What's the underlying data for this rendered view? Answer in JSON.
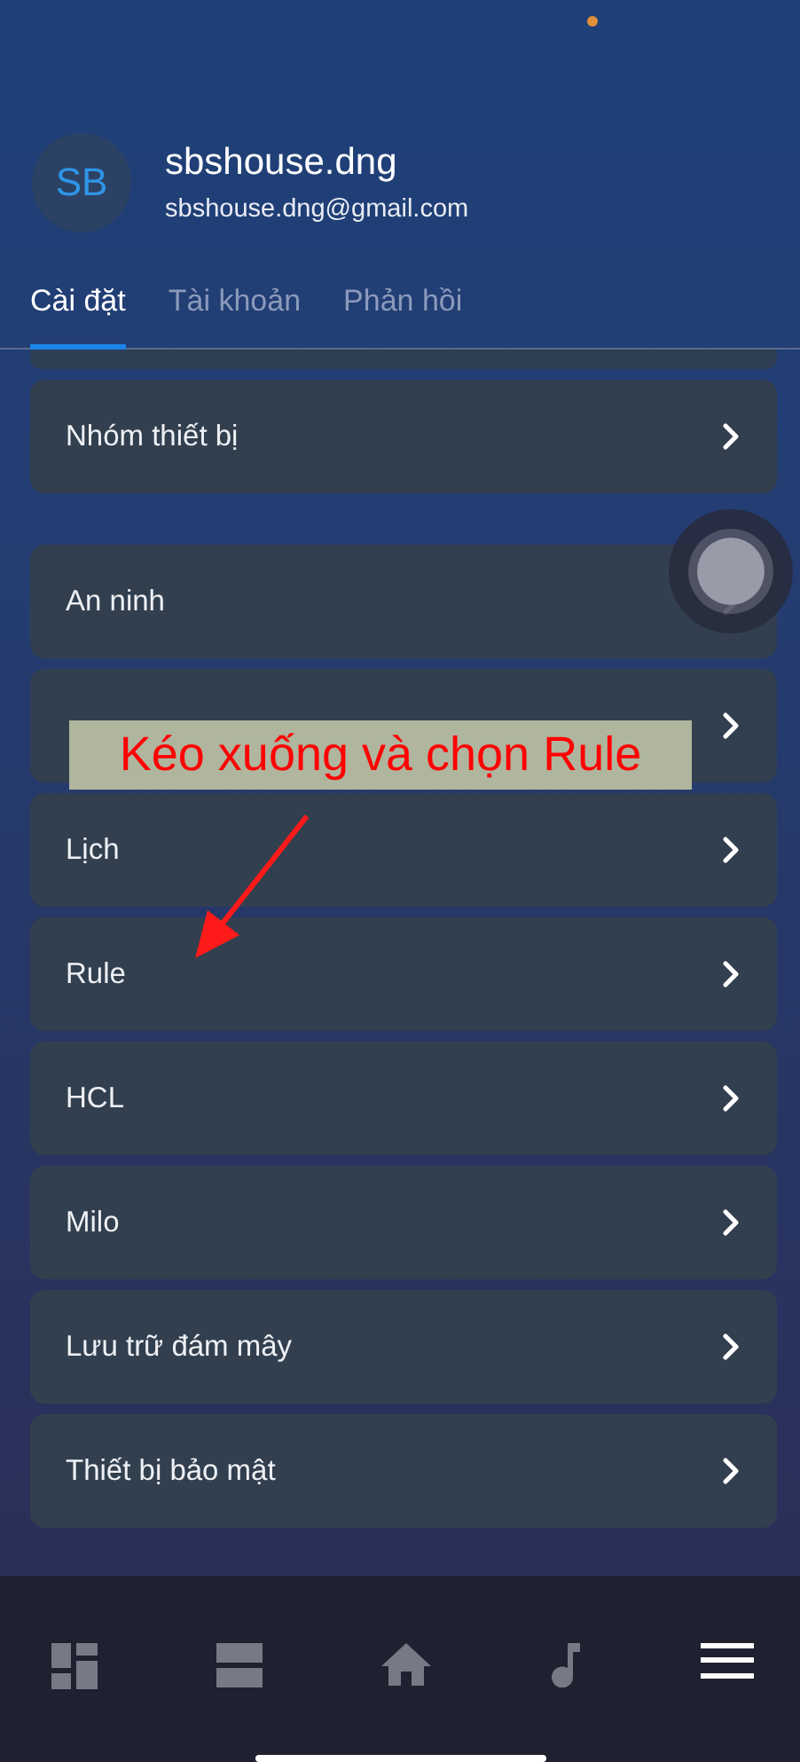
{
  "profile": {
    "initials": "SB",
    "name": "sbshouse.dng",
    "email": "sbshouse.dng@gmail.com"
  },
  "tabs": [
    {
      "label": "Cài đặt",
      "selected": true
    },
    {
      "label": "Tài khoản",
      "selected": false
    },
    {
      "label": "Phản hồi",
      "selected": false
    }
  ],
  "groups": [
    {
      "items": [
        {
          "kind": "cut"
        },
        {
          "kind": "row",
          "label": "Nhóm thiết bị"
        }
      ]
    },
    {
      "items": [
        {
          "kind": "row",
          "label": "An ninh"
        },
        {
          "kind": "covered"
        },
        {
          "kind": "row",
          "label": "Lịch"
        },
        {
          "kind": "row",
          "label": "Rule"
        },
        {
          "kind": "row",
          "label": "HCL"
        },
        {
          "kind": "row",
          "label": "Milo"
        },
        {
          "kind": "row",
          "label": "Lưu trữ đám mây"
        },
        {
          "kind": "row",
          "label": "Thiết bị bảo mật"
        }
      ]
    }
  ],
  "annotation": {
    "text": "Kéo xuống và chọn Rule"
  },
  "bottom_nav": [
    {
      "selected": false
    },
    {
      "selected": false
    },
    {
      "selected": false
    },
    {
      "selected": false
    },
    {
      "selected": true
    }
  ]
}
